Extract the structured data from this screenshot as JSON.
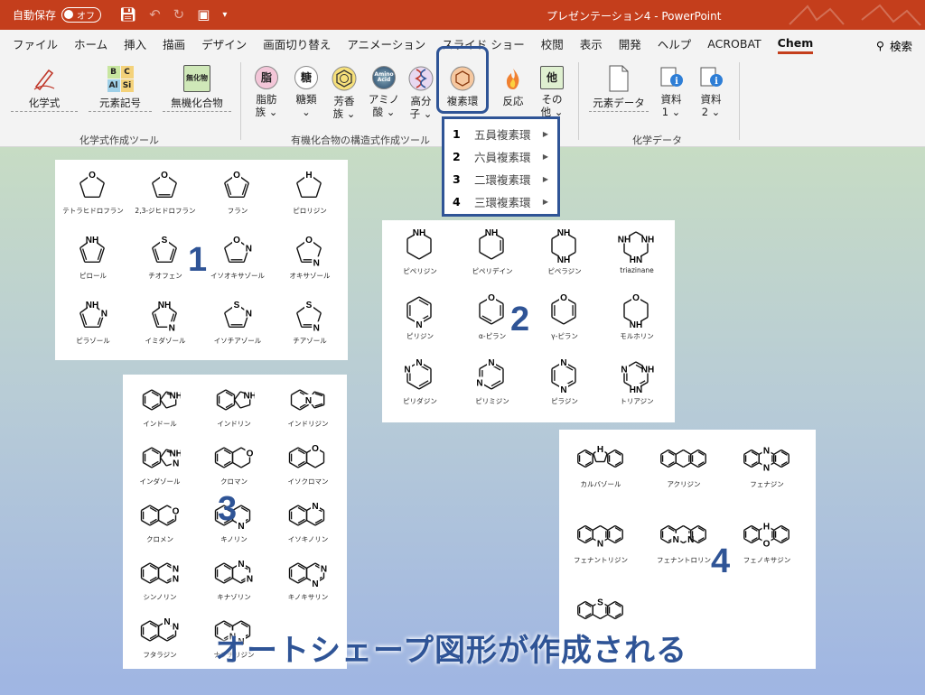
{
  "titlebar": {
    "autosave_label": "自動保存",
    "autosave_state": "オフ",
    "doc_title": "プレゼンテーション4  -  PowerPoint"
  },
  "tabs": [
    "ファイル",
    "ホーム",
    "挿入",
    "描画",
    "デザイン",
    "画面切り替え",
    "アニメーション",
    "スライド ショー",
    "校閲",
    "表示",
    "開発",
    "ヘルプ",
    "ACROBAT",
    "Chem"
  ],
  "active_tab": "Chem",
  "search_label": "検索",
  "ribbon": {
    "formula": "化学式",
    "element_symbol": "元素記号",
    "inorganic": "無機化合物",
    "inorganic_icon": "無化物",
    "group1": "化学式作成ツール",
    "fat": [
      "脂肪",
      "族 ⌄"
    ],
    "sugar": [
      "糖類",
      "⌄"
    ],
    "aromatic": [
      "芳香",
      "族 ⌄"
    ],
    "amino": [
      "アミノ",
      "酸 ⌄"
    ],
    "polymer": [
      "高分",
      "子 ⌄"
    ],
    "hetero": "複素環",
    "reaction": "反応",
    "other": [
      "その",
      "他 ⌄"
    ],
    "group2": "有機化合物の構造式作成ツール",
    "element_data": "元素データ",
    "data1": [
      "資料",
      "1 ⌄"
    ],
    "data2": [
      "資料",
      "2 ⌄"
    ],
    "group3": "化学データ",
    "ico_fat": "脂",
    "ico_sugar": "糖",
    "ico_other": "他",
    "ico_amino": "Amino Acid",
    "element_cells": [
      "B",
      "C",
      "Al",
      "Si"
    ]
  },
  "dropdown": [
    {
      "num": "1",
      "label": "五員複素環"
    },
    {
      "num": "2",
      "label": "六員複素環"
    },
    {
      "num": "3",
      "label": "二環複素環"
    },
    {
      "num": "4",
      "label": "三環複素環"
    }
  ],
  "panel1": [
    "テトラヒドロフラン",
    "2,3-ジヒドロフラン",
    "フラン",
    "ピロリジン",
    "ピロール",
    "チオフェン",
    "イソオキサゾール",
    "オキサゾール",
    "ピラゾール",
    "イミダゾール",
    "イソチアゾール",
    "チアゾール"
  ],
  "panel2": [
    "ピペリジン",
    "ピペリデイン",
    "ピペラジン",
    "triazinane",
    "ピリジン",
    "α-ピラン",
    "γ-ピラン",
    "モルホリン",
    "ピリダジン",
    "ピリミジン",
    "ピラジン",
    "トリアジン"
  ],
  "panel3": [
    "インドール",
    "インドリン",
    "インドリジン",
    "インダゾール",
    "クロマン",
    "イソクロマン",
    "クロメン",
    "キノリン",
    "イソキノリン",
    "シンノリン",
    "キナゾリン",
    "キノキサリン",
    "フタラジン",
    "ナフチリジン"
  ],
  "panel4": [
    "カルバゾール",
    "アクリジン",
    "フェナジン",
    "フェナントリジン",
    "フェナントロリン",
    "フェノキサジン",
    ""
  ],
  "atoms": {
    "O": "O",
    "N": "N",
    "H": "H",
    "S": "S",
    "NH": "NH",
    "HN": "HN"
  },
  "bignums": [
    "1",
    "2",
    "3",
    "4"
  ],
  "caption": "オートシェープ図形が作成される",
  "colors": {
    "titlebar": "#c43e1c",
    "accent": "#2f5496"
  }
}
